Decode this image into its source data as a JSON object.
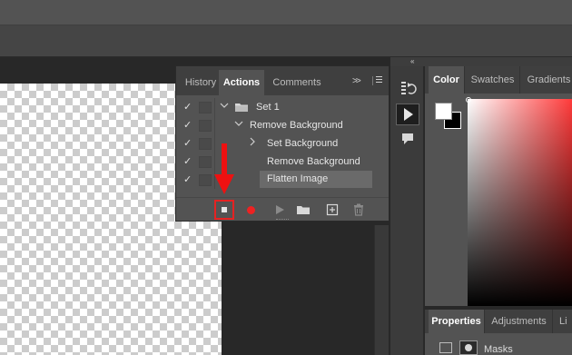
{
  "actions_panel": {
    "tabs": [
      {
        "label": "History",
        "active": false
      },
      {
        "label": "Actions",
        "active": true
      },
      {
        "label": "Comments",
        "active": false
      }
    ],
    "expand_icon": "double-chevron-right-icon",
    "menu_icon": "hamburger-menu-icon",
    "rows": [
      {
        "label": "Set 1",
        "checked": true,
        "icon": "folder-icon",
        "expanded": true
      },
      {
        "label": "Remove Background",
        "checked": true,
        "expanded": true
      },
      {
        "label": "Set Background",
        "checked": true,
        "expanded": false
      },
      {
        "label": "Remove Background",
        "checked": true
      },
      {
        "label": "Flatten Image",
        "checked": true,
        "selected": true
      }
    ],
    "toolbar": [
      "stop-playing-icon",
      "record-icon",
      "play-icon",
      "new-set-folder-icon",
      "new-action-icon",
      "delete-icon"
    ],
    "check_glyph": "✓",
    "stop_highlight_color": "#e52222"
  },
  "color_panel": {
    "tabs": [
      {
        "label": "Color",
        "active": true
      },
      {
        "label": "Swatches",
        "active": false
      },
      {
        "label": "Gradients",
        "active": false
      }
    ],
    "foreground": "#ffffff",
    "background": "#000000",
    "hue_color": "#ff3a3a"
  },
  "properties_panel": {
    "tabs": [
      {
        "label": "Properties",
        "active": true
      },
      {
        "label": "Adjustments",
        "active": false
      },
      {
        "label": "Li",
        "active": false
      }
    ],
    "masks_label": "Masks"
  },
  "toolstrip": {
    "collapse_icon": "«",
    "icons": [
      "history-tool-icon",
      "actions-tool-icon",
      "comments-tool-icon"
    ]
  },
  "annotation": {
    "arrow_color": "#ee1111"
  }
}
